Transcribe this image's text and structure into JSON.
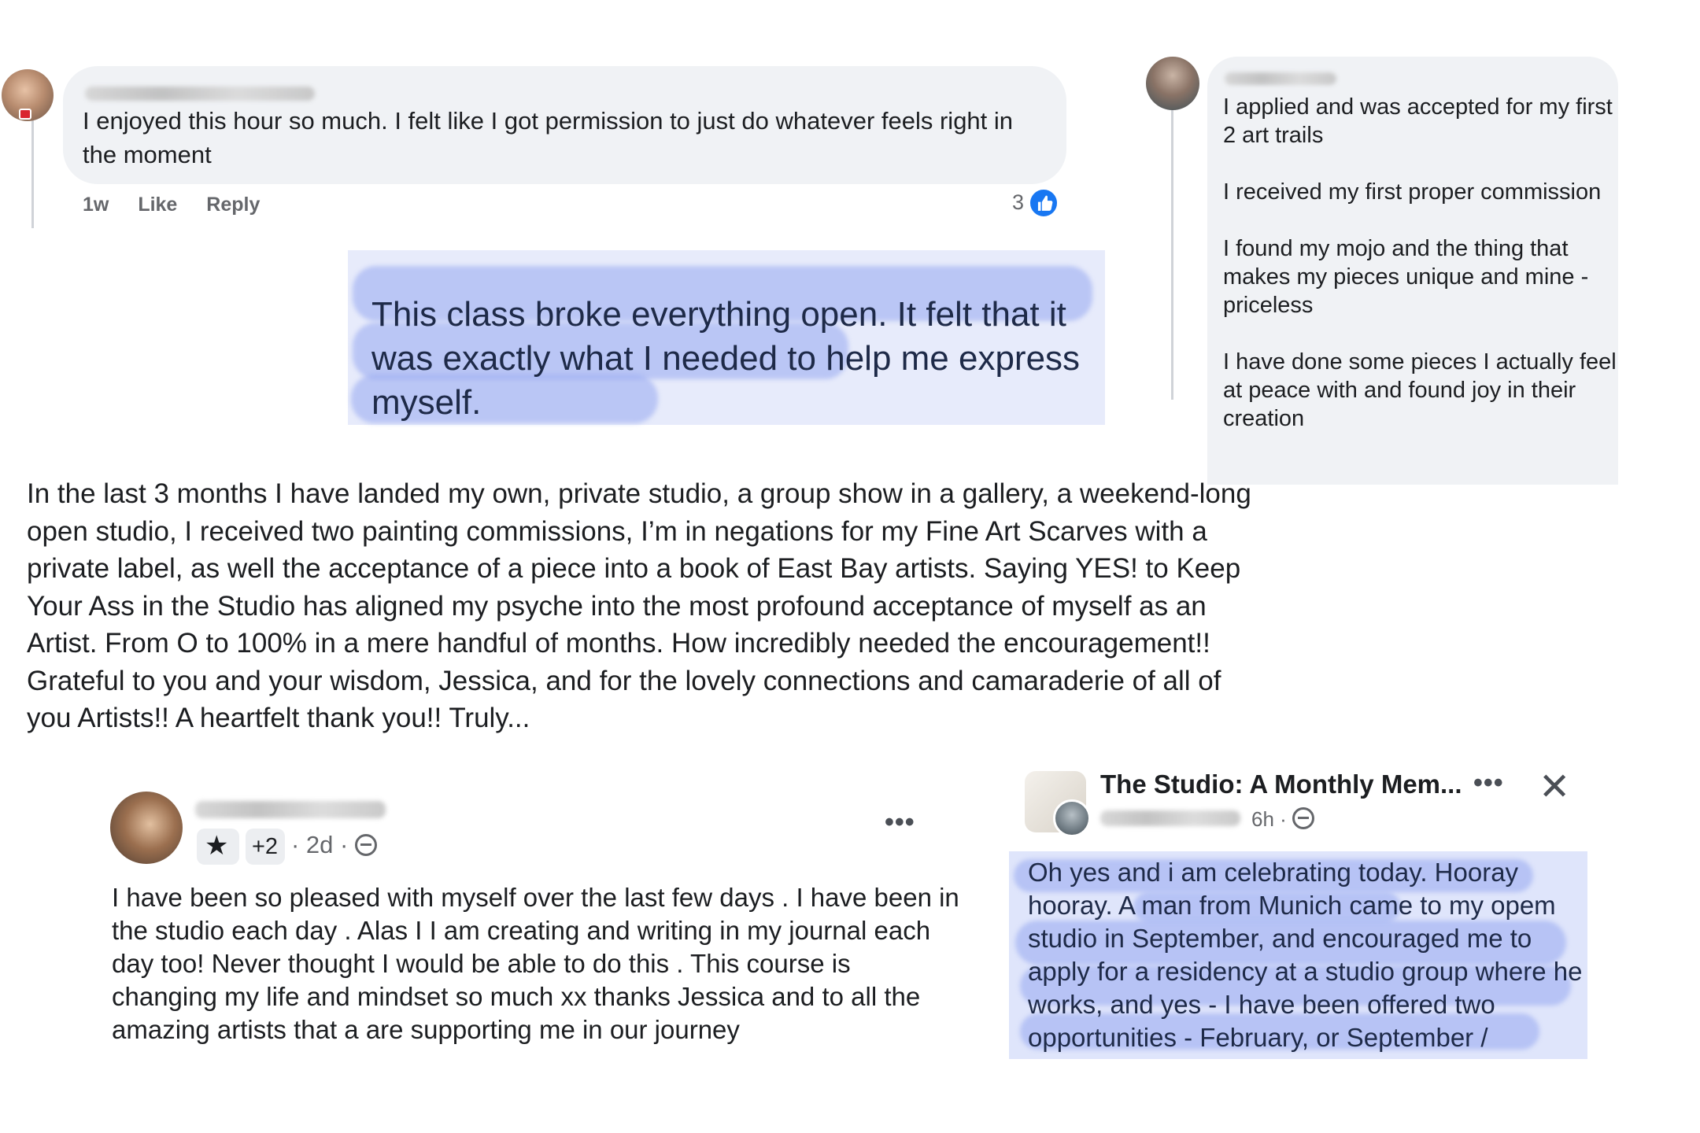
{
  "comment_top_left": {
    "text": "I enjoyed this hour so much. I felt like I got permission to just do whatever feels right in the moment",
    "time": "1w",
    "like_label": "Like",
    "reply_label": "Reply",
    "reaction_count": "3",
    "reaction_icon": "thumbs-up-icon"
  },
  "quote_highlight": {
    "text": "This class broke everything open. It felt that it was exactly what I needed to help me express myself."
  },
  "comment_right": {
    "items": [
      "I applied and was accepted for my first 2 art trails",
      "I received my first proper commission",
      "I found my mojo and the thing that makes my pieces unique and mine - priceless",
      "I have done some pieces I actually feel at peace with and found joy in their creation"
    ]
  },
  "long_testimonial": {
    "text": "In the last 3 months I have landed my own, private studio, a group show in a gallery, a weekend-long open studio, I received two painting commissions, I’m in negations for my Fine Art Scarves with a private label, as well the acceptance of a piece into a book of East Bay artists.   Saying YES! to Keep Your Ass in the Studio has aligned my psyche into the most profound acceptance of myself as an Artist. From O to 100% in a mere handful of months. How incredibly needed the encouragement!! Grateful to you and your wisdom, Jessica, and for the lovely connections and camaraderie   of all of you Artists!! A heartfelt thank you!! Truly..."
  },
  "post_bottom_left": {
    "badge_icon": "star-icon",
    "badge_count": "+2",
    "time": "· 2d ·",
    "more_label": "•••",
    "text": "I have been  so pleased with myself over the last few days . I have been in the studio each day . Alas I I am creating and writing in my journal each day too! Never thought I would be able to do this . This course is changing my life and mindset so much xx thanks Jessica and to all the amazing artists that a are supporting me in our journey"
  },
  "post_bottom_right": {
    "group_title": "The Studio: A Monthly Mem...",
    "more_label": "•••",
    "close_label": "✕",
    "time": "6h ·",
    "text": "Oh yes and i am celebrating today. Hooray hooray. A man from Munich came to my opem studio in September, and encouraged me to apply for a residency at a studio group where he works, and yes - I have been offered two opportunities - February, or September /"
  },
  "colors": {
    "facebook_blue": "#1877f2",
    "bubble_gray": "#f0f2f5",
    "highlight_blue": "#96a8f0",
    "meta_gray": "#65676b"
  }
}
